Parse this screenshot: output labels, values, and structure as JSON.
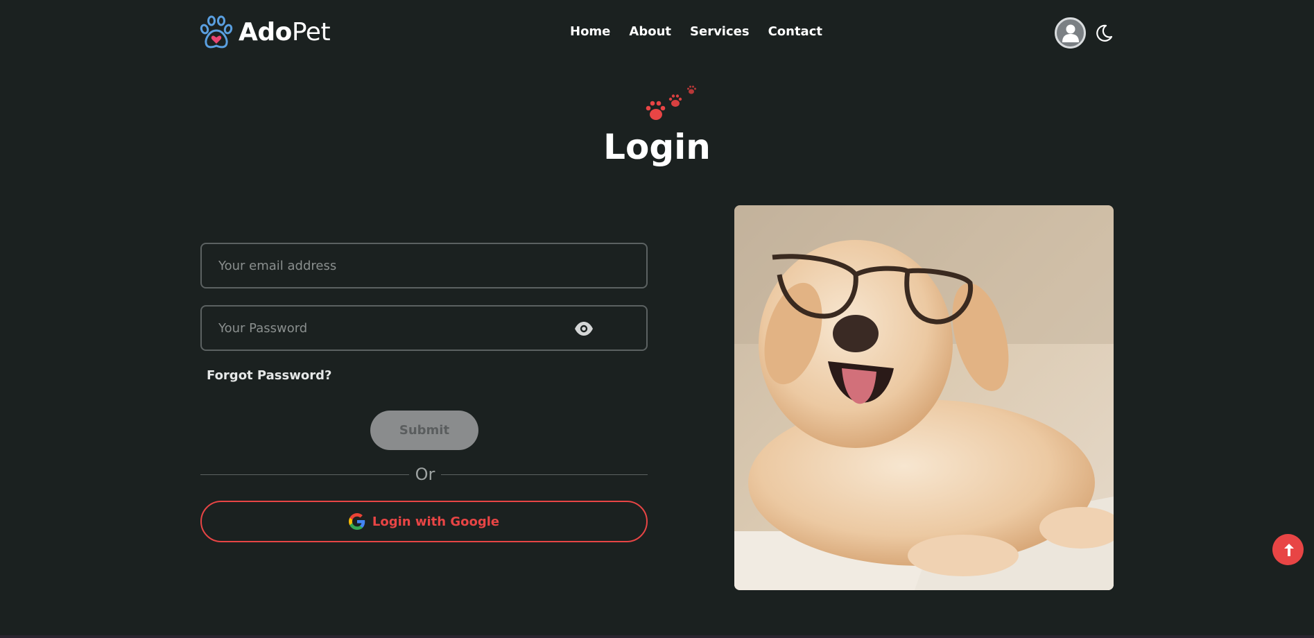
{
  "header": {
    "logo_bold": "Ado",
    "logo_light": "Pet",
    "logo_icon": "paw-heart-icon",
    "nav": [
      "Home",
      "About",
      "Services",
      "Contact"
    ],
    "avatar_icon": "user-icon",
    "theme_icon": "moon-icon"
  },
  "login": {
    "title": "Login",
    "email_placeholder": "Your email address",
    "password_placeholder": "Your Password",
    "forgot": "Forgot Password?",
    "submit": "Submit",
    "or": "Or",
    "google": "Login with Google"
  },
  "colors": {
    "background": "#1b2120",
    "accent": "#e84545",
    "logo_blue": "#5a9fe0",
    "submit_bg": "#8a8c8d"
  }
}
